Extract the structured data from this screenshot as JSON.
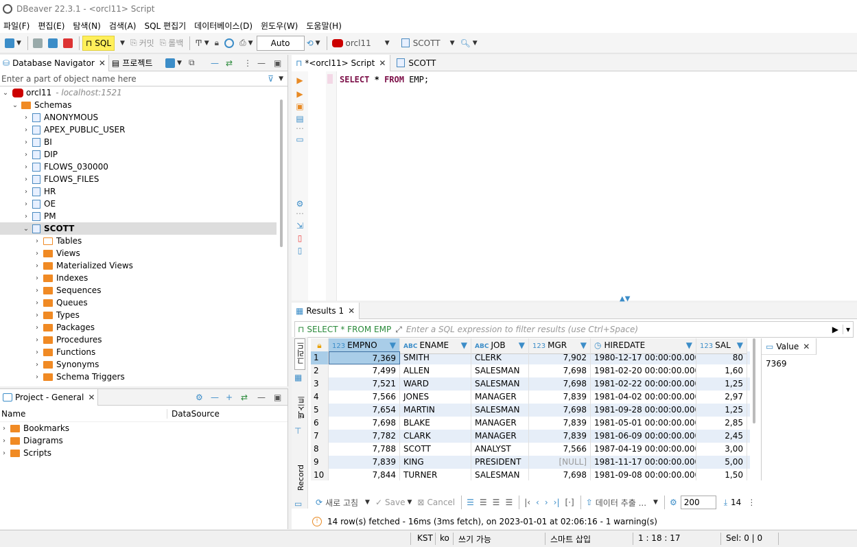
{
  "title": "DBeaver 22.3.1 - <orcl11> Script",
  "menu": [
    "파일(F)",
    "편집(E)",
    "탐색(N)",
    "검색(A)",
    "SQL 편집기",
    "데이터베이스(D)",
    "윈도우(W)",
    "도움말(H)"
  ],
  "toolbar": {
    "sql_label": "SQL",
    "commit_label": "커밋",
    "rollback_label": "롤백",
    "auto_label": "Auto",
    "connection": "orcl11",
    "schema": "SCOTT"
  },
  "navigator": {
    "tab_label": "Database Navigator",
    "project_tab_label": "프로젝트",
    "filter_placeholder": "Enter a part of object name here",
    "connection_name": "orcl11",
    "connection_host": "- localhost:1521",
    "schemas_label": "Schemas",
    "schemas": [
      "ANONYMOUS",
      "APEX_PUBLIC_USER",
      "BI",
      "DIP",
      "FLOWS_030000",
      "FLOWS_FILES",
      "HR",
      "OE",
      "PM",
      "SCOTT"
    ],
    "selected_schema": "SCOTT",
    "scott_children": [
      "Tables",
      "Views",
      "Materialized Views",
      "Indexes",
      "Sequences",
      "Queues",
      "Types",
      "Packages",
      "Procedures",
      "Functions",
      "Synonyms",
      "Schema Triggers"
    ]
  },
  "project": {
    "tab_label": "Project - General",
    "col_name": "Name",
    "col_datasource": "DataSource",
    "items": [
      "Bookmarks",
      "Diagrams",
      "Scripts"
    ]
  },
  "editor": {
    "tabs": [
      "*<orcl11> Script",
      "SCOTT"
    ],
    "code_kw1": "SELECT",
    "code_star": "*",
    "code_kw2": "FROM",
    "code_table": "EMP;"
  },
  "results": {
    "tab_label": "Results 1",
    "query_label": "SELECT * FROM EMP",
    "filter_placeholder": "Enter a SQL expression to filter results (use Ctrl+Space)",
    "side_grid": "그리드",
    "side_text": "텍스트",
    "side_record": "Record",
    "columns": [
      {
        "type": "123",
        "name": "EMPNO"
      },
      {
        "type": "ABC",
        "name": "ENAME"
      },
      {
        "type": "ABC",
        "name": "JOB"
      },
      {
        "type": "123",
        "name": "MGR"
      },
      {
        "type": "clock",
        "name": "HIREDATE"
      },
      {
        "type": "123",
        "name": "SAL"
      }
    ],
    "rows": [
      [
        "1",
        "7,369",
        "SMITH",
        "CLERK",
        "7,902",
        "1980-12-17 00:00:00.000",
        "80"
      ],
      [
        "2",
        "7,499",
        "ALLEN",
        "SALESMAN",
        "7,698",
        "1981-02-20 00:00:00.000",
        "1,60"
      ],
      [
        "3",
        "7,521",
        "WARD",
        "SALESMAN",
        "7,698",
        "1981-02-22 00:00:00.000",
        "1,25"
      ],
      [
        "4",
        "7,566",
        "JONES",
        "MANAGER",
        "7,839",
        "1981-04-02 00:00:00.000",
        "2,97"
      ],
      [
        "5",
        "7,654",
        "MARTIN",
        "SALESMAN",
        "7,698",
        "1981-09-28 00:00:00.000",
        "1,25"
      ],
      [
        "6",
        "7,698",
        "BLAKE",
        "MANAGER",
        "7,839",
        "1981-05-01 00:00:00.000",
        "2,85"
      ],
      [
        "7",
        "7,782",
        "CLARK",
        "MANAGER",
        "7,839",
        "1981-06-09 00:00:00.000",
        "2,45"
      ],
      [
        "8",
        "7,788",
        "SCOTT",
        "ANALYST",
        "7,566",
        "1987-04-19 00:00:00.000",
        "3,00"
      ],
      [
        "9",
        "7,839",
        "KING",
        "PRESIDENT",
        "[NULL]",
        "1981-11-17 00:00:00.000",
        "5,00"
      ],
      [
        "10",
        "7,844",
        "TURNER",
        "SALESMAN",
        "7,698",
        "1981-09-08 00:00:00.000",
        "1,50"
      ]
    ],
    "value_panel_label": "Value",
    "value": "7369",
    "refresh_label": "새로 고침",
    "save_label": "Save",
    "cancel_label": "Cancel",
    "export_label": "데이터 추출 ...",
    "fetch_size": "200",
    "row_count": "14",
    "status_message": "14 row(s) fetched - 16ms (3ms fetch), on 2023-01-01 at 02:06:16 - 1 warning(s)"
  },
  "statusbar": {
    "timezone": "KST",
    "locale": "ko",
    "write_mode": "쓰기 가능",
    "insert_mode": "스마트 삽입",
    "position": "1 : 18 : 17",
    "selection": "Sel: 0 | 0"
  },
  "colors": {
    "selected_header": "#a9cde8",
    "alt_row": "#e6eef8",
    "keyword": "#7b0e47",
    "sql_button": "#ffef5a"
  }
}
